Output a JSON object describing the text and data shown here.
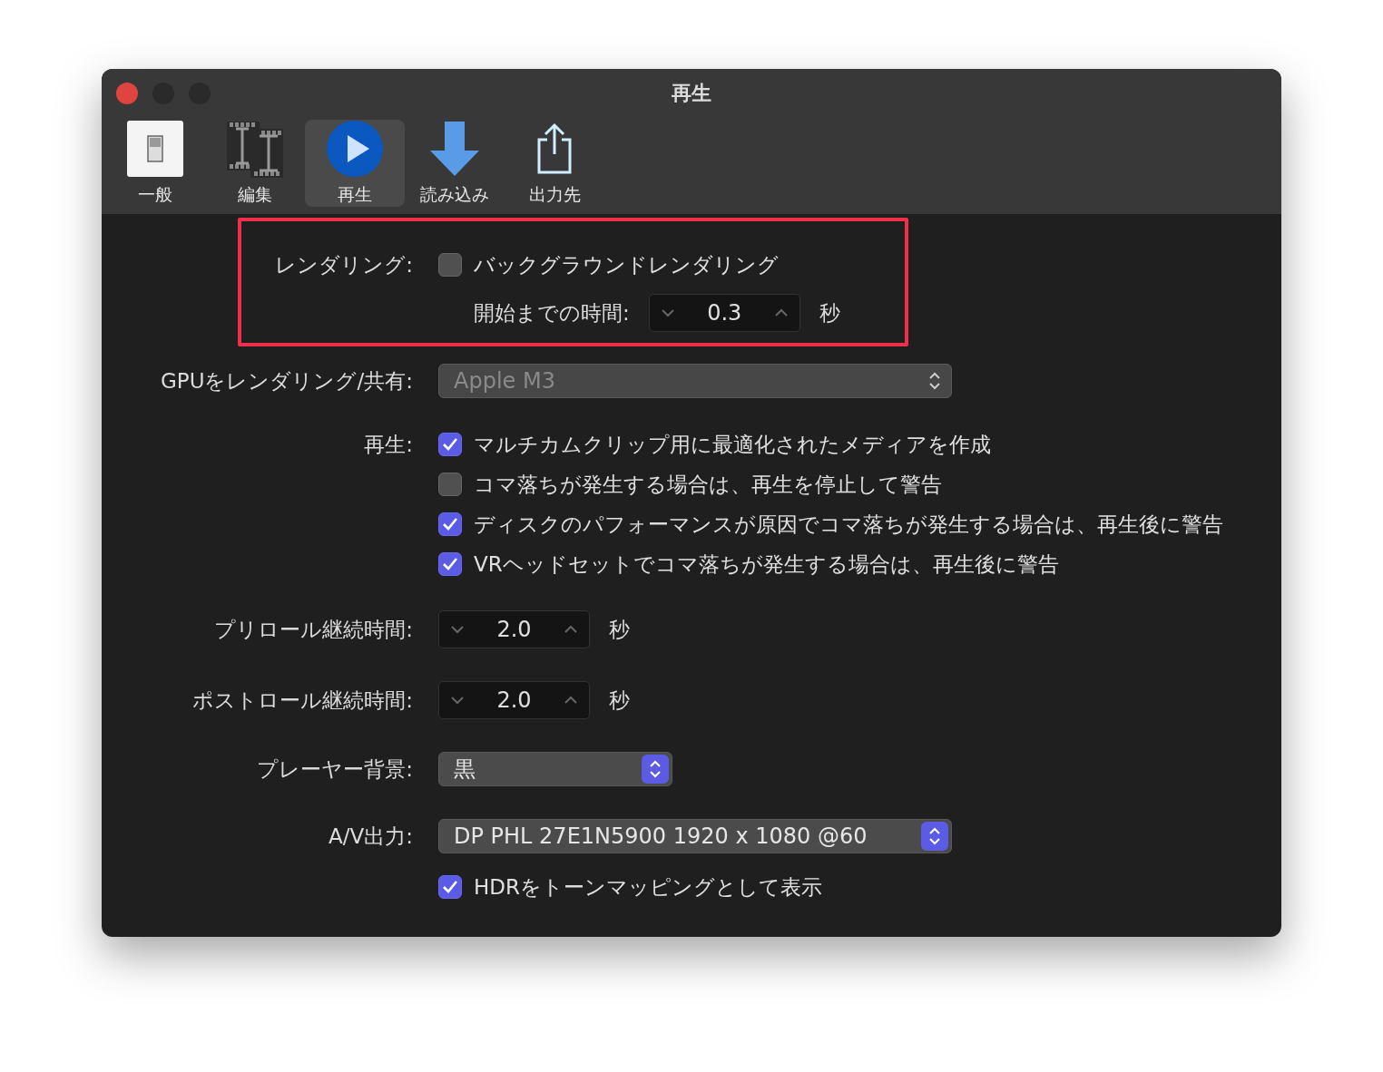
{
  "window": {
    "title": "再生"
  },
  "toolbar": [
    {
      "label": "一般",
      "kind": "general",
      "selected": false
    },
    {
      "label": "編集",
      "kind": "editing",
      "selected": false
    },
    {
      "label": "再生",
      "kind": "playback",
      "selected": true
    },
    {
      "label": "読み込み",
      "kind": "import",
      "selected": false
    },
    {
      "label": "出力先",
      "kind": "destinations",
      "selected": false
    }
  ],
  "rendering": {
    "label": "レンダリング:",
    "option": {
      "label": "バックグラウンドレンダリング",
      "checked": false
    },
    "delay": {
      "label": "開始までの時間:",
      "value": "0.3",
      "unit": "秒"
    }
  },
  "gpu": {
    "label": "GPUをレンダリング/共有:",
    "value": "Apple M3",
    "disabled": true
  },
  "playback": {
    "label": "再生:",
    "options": [
      {
        "label": "マルチカムクリップ用に最適化されたメディアを作成",
        "checked": true
      },
      {
        "label": "コマ落ちが発生する場合は、再生を停止して警告",
        "checked": false
      },
      {
        "label": "ディスクのパフォーマンスが原因でコマ落ちが発生する場合は、再生後に警告",
        "checked": true
      },
      {
        "label": "VRヘッドセットでコマ落ちが発生する場合は、再生後に警告",
        "checked": true
      }
    ]
  },
  "preroll": {
    "label": "プリロール継続時間:",
    "value": "2.0",
    "unit": "秒"
  },
  "postroll": {
    "label": "ポストロール継続時間:",
    "value": "2.0",
    "unit": "秒"
  },
  "player_background": {
    "label": "プレーヤー背景:",
    "value": "黒"
  },
  "av_output": {
    "label": "A/V出力:",
    "value": "DP PHL 27E1N5900 1920 x 1080 @60",
    "option": {
      "label": "HDRをトーンマッピングとして表示",
      "checked": true
    }
  }
}
